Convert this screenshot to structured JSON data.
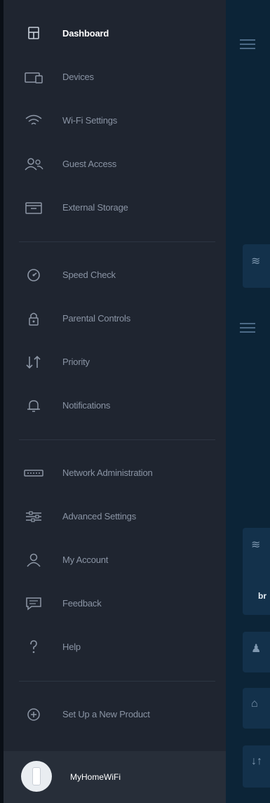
{
  "nav": {
    "items": [
      {
        "label": "Dashboard",
        "icon": "dashboard-icon",
        "active": true
      },
      {
        "label": "Devices",
        "icon": "devices-icon"
      },
      {
        "label": "Wi-Fi Settings",
        "icon": "wifi-icon"
      },
      {
        "label": "Guest Access",
        "icon": "guest-access-icon"
      },
      {
        "label": "External Storage",
        "icon": "external-storage-icon"
      },
      {
        "label": "Speed Check",
        "icon": "speed-check-icon"
      },
      {
        "label": "Parental Controls",
        "icon": "parental-controls-icon"
      },
      {
        "label": "Priority",
        "icon": "priority-icon"
      },
      {
        "label": "Notifications",
        "icon": "bell-icon"
      },
      {
        "label": "Network Administration",
        "icon": "network-admin-icon"
      },
      {
        "label": "Advanced Settings",
        "icon": "sliders-icon"
      },
      {
        "label": "My Account",
        "icon": "user-icon"
      },
      {
        "label": "Feedback",
        "icon": "feedback-icon"
      },
      {
        "label": "Help",
        "icon": "help-icon"
      },
      {
        "label": "Set Up a New Product",
        "icon": "add-icon"
      }
    ]
  },
  "footer": {
    "network_name": "MyHomeWiFi"
  },
  "background": {
    "peek_text": "br"
  }
}
